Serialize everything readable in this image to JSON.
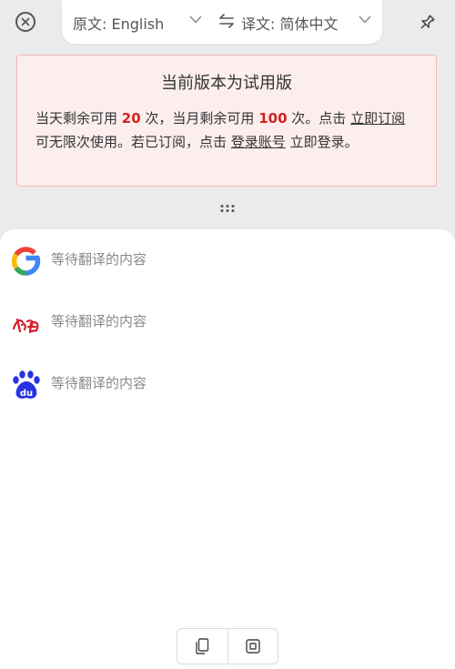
{
  "header": {
    "source_label": "原文: English",
    "target_label": "译文: 简体中文",
    "icons": [
      "close-icon",
      "chevron-down-icon",
      "swap-icon",
      "pin-icon"
    ]
  },
  "trial": {
    "title": "当前版本为试用版",
    "seg1": "当天剩余可用 ",
    "daily_remaining": "20",
    "seg2": " 次，当月剩余可用 ",
    "monthly_remaining": "100",
    "seg3": " 次。点击 ",
    "subscribe_link": "立即订阅",
    "seg4": " 可无限次使用。若已订阅，点击 ",
    "login_link": "登录账号",
    "seg5": " 立即登录。",
    "colors": {
      "background": "#fdeeee",
      "border": "#f2b7b7",
      "highlight": "#d42222"
    }
  },
  "results": {
    "engines": [
      {
        "icon": "google-icon",
        "placeholder": "等待翻译的内容"
      },
      {
        "icon": "youdao-icon",
        "placeholder": "等待翻译的内容"
      },
      {
        "icon": "baidu-icon",
        "placeholder": "等待翻译的内容"
      }
    ]
  },
  "toolbar": {
    "icons": [
      "copy-icon",
      "screenshot-icon"
    ]
  }
}
